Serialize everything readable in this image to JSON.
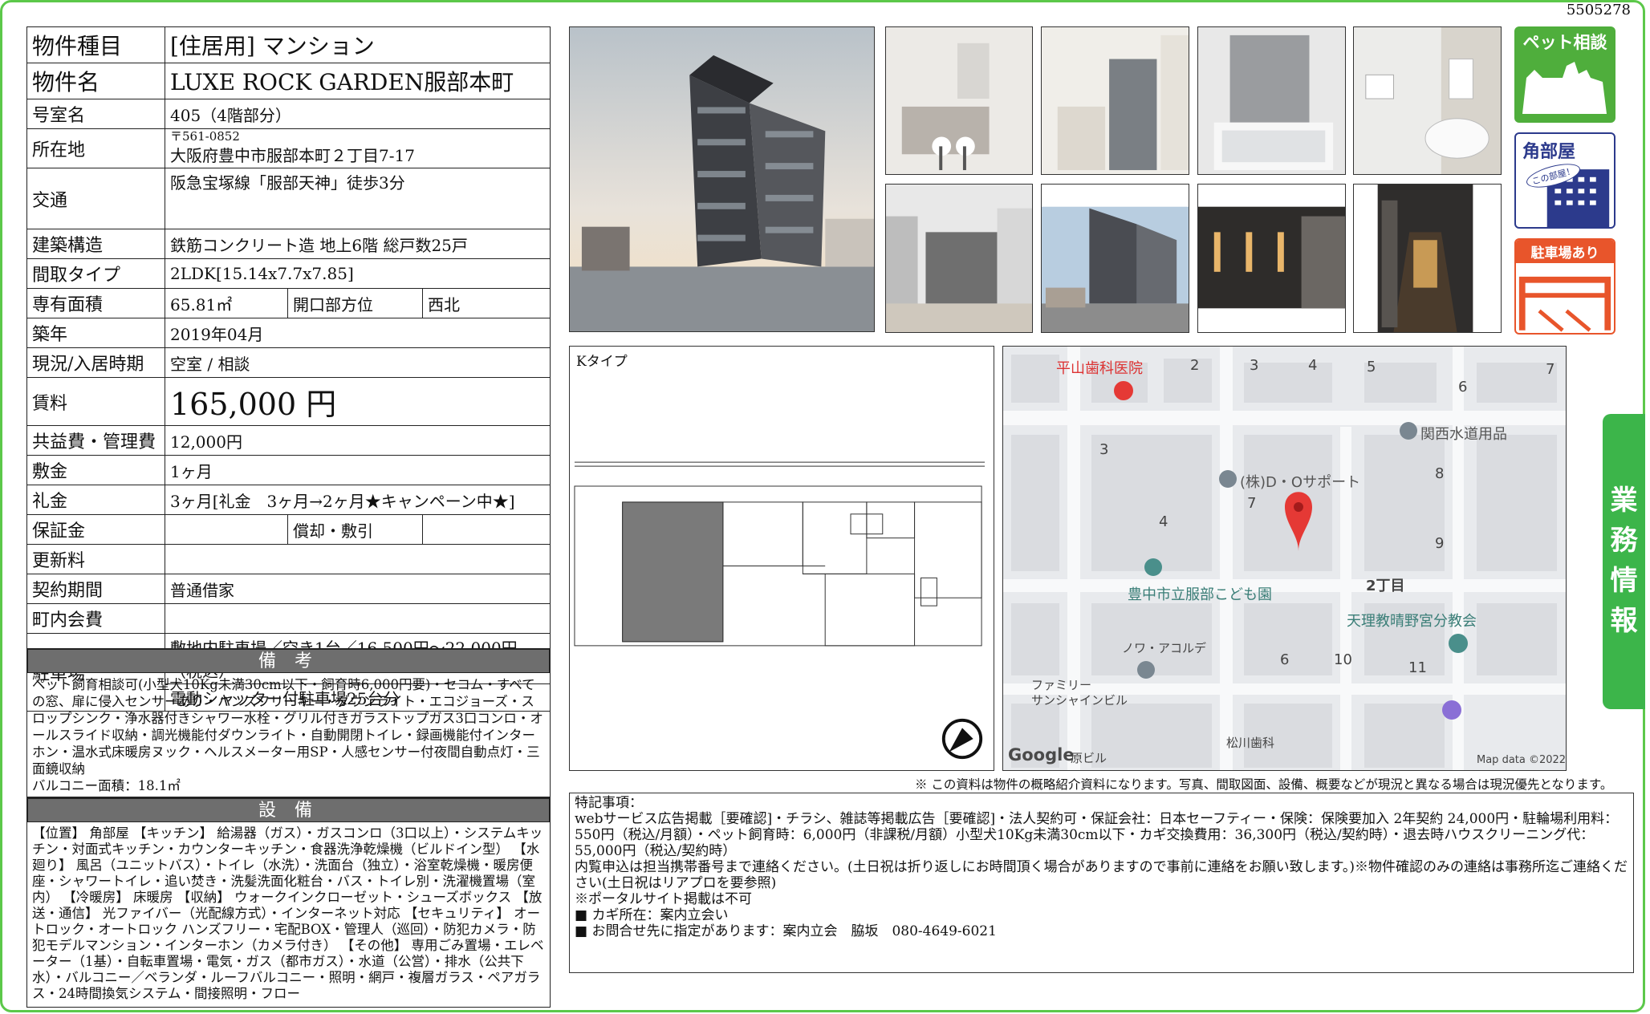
{
  "doc_number": "5505278",
  "table": {
    "type_label": "物件種目",
    "type_value": "[住居用] マンション",
    "name_label": "物件名",
    "name_value": "LUXE ROCK GARDEN服部本町",
    "room_label": "号室名",
    "room_value": "405（4階部分）",
    "addr_label": "所在地",
    "postal": "〒561-0852",
    "addr_value": "大阪府豊中市服部本町２丁目7-17",
    "transport_label": "交通",
    "transport_value": "阪急宝塚線「服部天神」徒歩3分",
    "structure_label": "建築構造",
    "structure_value": "鉄筋コンクリート造 地上6階 総戸数25戸",
    "layout_label": "間取タイプ",
    "layout_value": "2LDK[15.14x7.7x7.85]",
    "area_label": "専有面積",
    "area_value": "65.81㎡",
    "facing_label": "開口部方位",
    "facing_value": "西北",
    "built_label": "築年",
    "built_value": "2019年04月",
    "status_label": "現況/入居時期",
    "status_value": "空室 / 相談",
    "rent_label": "賃料",
    "rent_value": "165,000 円",
    "fee_label": "共益費・管理費",
    "fee_value": "12,000円",
    "deposit_label": "敷金",
    "deposit_value": "1ヶ月",
    "key_label": "礼金",
    "key_value": "3ヶ月[礼金　3ヶ月→2ヶ月★キャンペーン中★]",
    "guarantee_label": "保証金",
    "guarantee_value": "",
    "amort_label": "償却・敷引",
    "amort_value": "",
    "renewal_label": "更新料",
    "renewal_value": "",
    "contract_label": "契約期間",
    "contract_value": "普通借家",
    "community_label": "町内会費",
    "community_value": "",
    "parking_label": "駐車場",
    "parking_value1": "敷地内駐車場／空き1台／16,500円〜22,000円（税込）",
    "parking_value2": "電動シャッター付駐車場25台分"
  },
  "remarks": {
    "heading": "備 考",
    "text": "ペット飼育相談可(小型犬10Kg未満30cm以下・飼育時6,000円要)・セコム・すべての窓、扉に侵入センサーあり・ハンズフリーキー・ダウンライト・エコジョーズ・スロップシンク・浄水器付きシャワー水栓・グリル付きガラストップガス3口コンロ・オールスライド収納・調光機能付ダウンライト・自動開閉トイレ・録画機能付インターホン・温水式床暖房ヌック・ヘルスメーター用SP・人感センサー付夜間自動点灯・三面鏡収納",
    "balcony": "バルコニー面積：18.1㎡"
  },
  "equipment": {
    "heading": "設 備",
    "text": "【位置】 角部屋 【キッチン】 給湯器（ガス）・ガスコンロ（3口以上）・システムキッチン・対面式キッチン・カウンターキッチン・食器洗浄乾燥機（ビルドイン型） 【水廻り】 風呂（ユニットバス）・トイレ（水洗）・洗面台（独立）・浴室乾燥機・暖房便座・シャワートイレ・追い焚き・洗髪洗面化粧台・バス・トイレ別・洗濯機置場（室内） 【冷暖房】 床暖房 【収納】 ウォークインクローゼット・シューズボックス 【放送・通信】 光ファイバー（光配線方式）・インターネット対応 【セキュリティ】 オートロック・オートロック ハンズフリー・宅配BOX・管理人（巡回）・防犯カメラ・防犯モデルマンション・インターホン（カメラ付き） 【その他】 専用ごみ置場・エレベーター（1基）・自転車置場・電気・ガス（都市ガス）・水道（公営）・排水（公共下水）・バルコニー／ベランダ・ルーフバルコニー・照明・網戸・複層ガラス・ペアガラス・24時間換気システム・間接照明・フロー"
  },
  "badges": {
    "pet": "ペット相談",
    "corner": "角部屋",
    "corner_sub": "この部屋！",
    "parking": "駐車場あり"
  },
  "floorplan": {
    "label": "Kタイプ"
  },
  "map": {
    "labels": [
      "平山歯科医院",
      "関西水道用品",
      "(株)D・Oサポート",
      "豊中市立服部こども園",
      "天理教晴野宮分教会",
      "ノワ・アコルデ",
      "ファミリー",
      "サンシャインビル",
      "松川歯科",
      "2丁目",
      "Google",
      "原ビル",
      "Map data ©2022"
    ],
    "blocks": [
      "2",
      "3",
      "4",
      "5",
      "6",
      "7",
      "3",
      "8",
      "4",
      "7",
      "9",
      "6",
      "10",
      "11"
    ]
  },
  "disclaimer": "※ この資料は物件の概略紹介資料になります。写真、間取図面、設備、概要などが現況と異なる場合は現況優先となります。",
  "notes": {
    "lines": [
      "特記事項：",
      "webサービス広告掲載［要確認]・チラシ、雑誌等掲載広告［要確認]・法人契約可・保証会社：日本セーフティー・保険：保険要加入 2年契約 24,000円・駐輪場利用料：550円（税込/月額）・ペット飼育時：6,000円（非課税/月額）小型犬10Kg未満30cm以下・カギ交換費用：36,300円（税込/契約時）・退去時ハウスクリーニング代：55,000円（税込/契約時）",
      "内覧申込は担当携帯番号まで連絡ください。(土日祝は折り返しにお時間頂く場合がありますので事前に連絡をお願い致します。)※物件確認のみの連絡は事務所迄ご連絡ください(土日祝はリアプロを要参照)",
      "※ポータルサイト掲載は不可",
      "■ カギ所在：案内立会い",
      "■ お問合せ先に指定があります：案内立会　脇坂　080-4649-6021"
    ]
  },
  "side_tab": [
    "業",
    "務",
    "情",
    "報"
  ],
  "colors": {
    "accent_green": "#3cb54a",
    "badge_orange": "#e8552b",
    "badge_blue": "#2c3a8c",
    "section_gray": "#6e6e6e",
    "pin_red": "#e53935"
  }
}
